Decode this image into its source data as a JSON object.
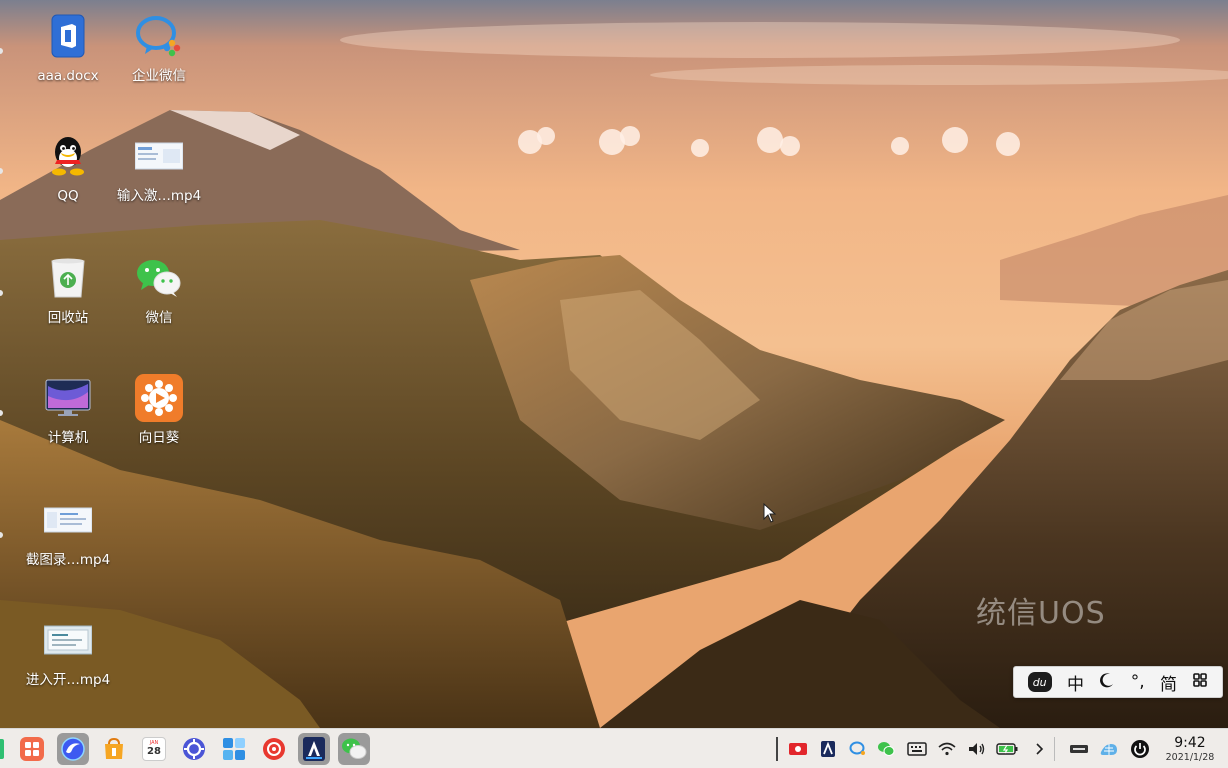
{
  "desktop": {
    "watermark": "统信UOS",
    "icons": [
      {
        "label": "aaa.docx",
        "icon": "document-icon"
      },
      {
        "label": "企业微信",
        "icon": "wecom-icon"
      },
      {
        "label": "QQ",
        "icon": "qq-icon"
      },
      {
        "label": "输入激…mp4",
        "icon": "video-thumbnail-icon"
      },
      {
        "label": "回收站",
        "icon": "trash-icon"
      },
      {
        "label": "微信",
        "icon": "wechat-icon"
      },
      {
        "label": "计算机",
        "icon": "computer-icon"
      },
      {
        "label": "向日葵",
        "icon": "sunflower-icon"
      },
      {
        "label": "截图录…mp4",
        "icon": "video-thumbnail-icon"
      },
      {
        "label": "进入开…mp4",
        "icon": "video-thumbnail-icon"
      }
    ]
  },
  "ime": {
    "logo": "du",
    "lang": "中",
    "punct": "°,",
    "mode": "简"
  },
  "taskbar": {
    "apps": [
      "launcher-icon",
      "browser-icon",
      "app-store-icon",
      "calendar-icon",
      "settings-icon",
      "file-manager-icon",
      "music-icon",
      "cloud-print-icon",
      "wechat-icon"
    ],
    "calendar_day": "28",
    "calendar_month": "JAN",
    "clock": {
      "time": "9:42",
      "date": "2021/1/28"
    }
  },
  "colors": {
    "taskbar_bg": "#eeeeee",
    "accent_orange": "#f07c2a",
    "wechat_green": "#3ec24b"
  }
}
